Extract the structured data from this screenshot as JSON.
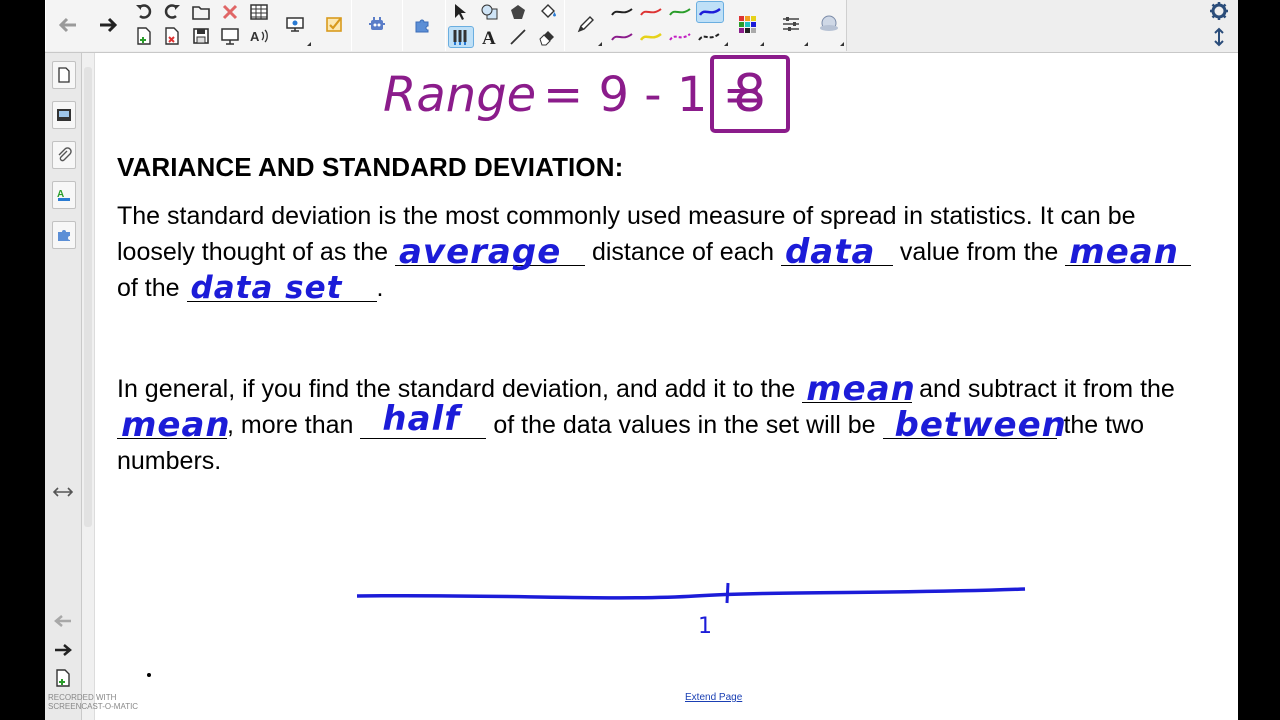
{
  "page": {
    "handwriting": {
      "range_label": "Range",
      "range_expr": "= 9 - 1 =",
      "range_result": "8",
      "number_line_tick": "1"
    },
    "heading": "VARIANCE AND STANDARD DEVIATION:",
    "para1": {
      "t1": "The standard deviation is the most commonly used measure of spread in statistics. It can be loosely thought of as the",
      "fill1": "average",
      "t2": "distance of each",
      "fill2": "data",
      "t3": "value from the",
      "fill3": "mean",
      "t4": "of the",
      "fill4": "data set",
      "t5": "."
    },
    "para2": {
      "t1": "In general, if you find the standard deviation, and add it to the",
      "fill1": "mean",
      "t2": "and subtract it from the",
      "fill2": "mean",
      "t3": ", more than",
      "fill3": "half",
      "t4": "of the data values in the set will be",
      "fill4": "between",
      "t5": "the two numbers."
    },
    "extend_link": "Extend Page"
  },
  "watermark": {
    "line1": "RECORDED WITH",
    "line2": "SCREENCAST-O-MATIC"
  },
  "colors": {
    "ink_blue": "#1c1cd8",
    "ink_purple": "#8b1c8b",
    "toolbar_bg": "#eeeeee",
    "active_tool": "#bfe0f7"
  },
  "icons": {
    "toolbar": [
      "back-arrow-icon",
      "forward-arrow-icon",
      "undo-icon",
      "redo-icon",
      "open-file-icon",
      "delete-icon",
      "table-icon",
      "new-page-icon",
      "delete-page-icon",
      "save-icon",
      "screen-capture-icon",
      "text-to-speech-icon",
      "screen-share-icon",
      "lesson-activity-icon",
      "add-on-icon",
      "extension-icon",
      "select-icon",
      "shapes-icon",
      "polygon-icon",
      "fill-icon",
      "pens-icon",
      "text-icon",
      "line-icon",
      "eraser-icon",
      "magic-pen-icon",
      "colour-palette-icon",
      "properties-icon",
      "3d-icon",
      "settings-icon",
      "toolbar-position-icon"
    ],
    "sidebar": [
      "page-sorter-icon",
      "gallery-icon",
      "attachments-icon",
      "properties-icon",
      "add-ons-icon",
      "resize-arrows-icon",
      "prev-page-icon",
      "next-page-icon",
      "add-page-icon"
    ]
  }
}
